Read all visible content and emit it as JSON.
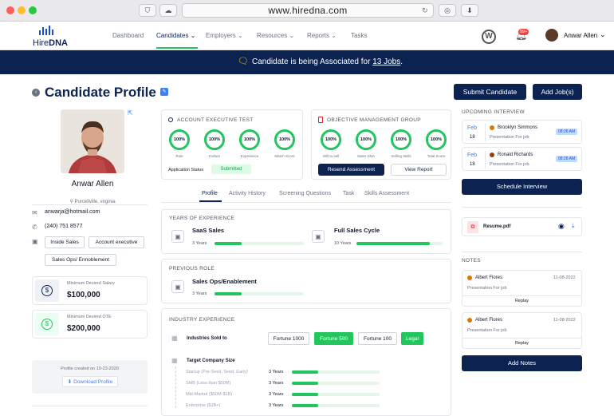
{
  "browser": {
    "url": "www.hiredna.com"
  },
  "nav": {
    "logo_hire": "Hire",
    "logo_dna": "DNA",
    "items": [
      "Dashboard",
      "Candidates",
      "Employers",
      "Resources",
      "Reports",
      "Tasks"
    ],
    "notif_count": "99+",
    "user_name": "Anwar Allen"
  },
  "banner": {
    "prefix": "Candidate is being Associated for ",
    "link": "13 Jobs",
    "suffix": "."
  },
  "page": {
    "title": "Candidate Profile",
    "submit_btn": "Submit Candidate",
    "add_job_btn": "Add Job(s)"
  },
  "profile": {
    "name": "Anwar Allen",
    "location": "Purcellville, virginia",
    "email": "anwarja@hotmail.com",
    "phone": "(240) 751 8577",
    "tags": [
      "Inside Sales",
      "Account executive",
      "Sales Ops/ Ennoblement"
    ],
    "salary_label": "Minimum Desired Salary",
    "salary": "$100,000",
    "ote_label": "Minimum Desired OTE",
    "ote": "$200,000",
    "created": "Profile created on 10-23-2020",
    "download": "Download Profile"
  },
  "test": {
    "title": "ACCOUNT EXECUTIVE TEST",
    "scores": [
      {
        "value": "100%",
        "label": "Role"
      },
      {
        "value": "100%",
        "label": "Culture"
      },
      {
        "value": "100%",
        "label": "Experience"
      },
      {
        "value": "100%",
        "label": "Match Score"
      }
    ],
    "status_label": "Application Status",
    "status": "Submitted"
  },
  "group": {
    "title": "OBJECTIVE MANAGEMENT GROUP",
    "scores": [
      {
        "value": "100%",
        "label": "Will to sell"
      },
      {
        "value": "100%",
        "label": "Sales DNA"
      },
      {
        "value": "100%",
        "label": "Selling Skills"
      },
      {
        "value": "100%",
        "label": "Total Score"
      }
    ],
    "resend": "Resend Assessment",
    "view": "View Report"
  },
  "tabs": [
    "Profile",
    "Activity History",
    "Screening Questions",
    "Task",
    "Skills Assessment"
  ],
  "experience": {
    "title": "YEARS OF EXPERIENCE",
    "items": [
      {
        "name": "SaaS Sales",
        "years": "3 Years",
        "fill": 0.3
      },
      {
        "name": "Full Sales Cycle",
        "years": "10 Years",
        "fill": 0.85
      }
    ]
  },
  "prev_role": {
    "title": "PREVIOUS ROLE",
    "name": "Sales Ops/Enablement",
    "years": "3 Years",
    "fill": 0.3
  },
  "industry": {
    "title": "INDUSTRY EXPERIENCE",
    "sold_label": "Industries Sold to",
    "chips": [
      {
        "label": "Fortune 1000",
        "active": false
      },
      {
        "label": "Fortune 500",
        "active": true
      },
      {
        "label": "Fortune 100",
        "active": false
      },
      {
        "label": "Legal",
        "active": true
      }
    ],
    "target_label": "Target Company Size",
    "sizes": [
      {
        "label": "Startup (Pre-Seed, Seed, Early)",
        "years": "3 Years",
        "fill": 0.3
      },
      {
        "label": "SMB (Less than $50M)",
        "years": "3 Years",
        "fill": 0.3
      },
      {
        "label": "Mid-Market ($50M-$1B)",
        "years": "3 Years",
        "fill": 0.3
      },
      {
        "label": "Enterprise ($1B+)",
        "years": "3 Years",
        "fill": 0.3
      }
    ]
  },
  "interviews": {
    "title": "UPCOMING INTERVIEW",
    "items": [
      {
        "month": "Feb",
        "day": "18",
        "name": "Brooklyn Simmons",
        "sub": "Presentation For job",
        "time": "08:26 AM"
      },
      {
        "month": "Feb",
        "day": "18",
        "name": "Ronald Richards",
        "sub": "Presentation For job",
        "time": "08:26 AM"
      }
    ],
    "schedule_btn": "Schedule Interview"
  },
  "resume": {
    "file": "Resume.pdf"
  },
  "notes": {
    "title": "NOTES",
    "items": [
      {
        "name": "Albert Flores",
        "date": "11-08-2022",
        "text": "Presentation For job",
        "reply": "Replay"
      },
      {
        "name": "Albert Flores",
        "date": "11-08-2022",
        "text": "Presentation For job",
        "reply": "Replay"
      }
    ],
    "add_btn": "Add Notes"
  },
  "colors": {
    "navy": "#0c2352",
    "green": "#22c55e",
    "accent": "#1d4ed8"
  }
}
